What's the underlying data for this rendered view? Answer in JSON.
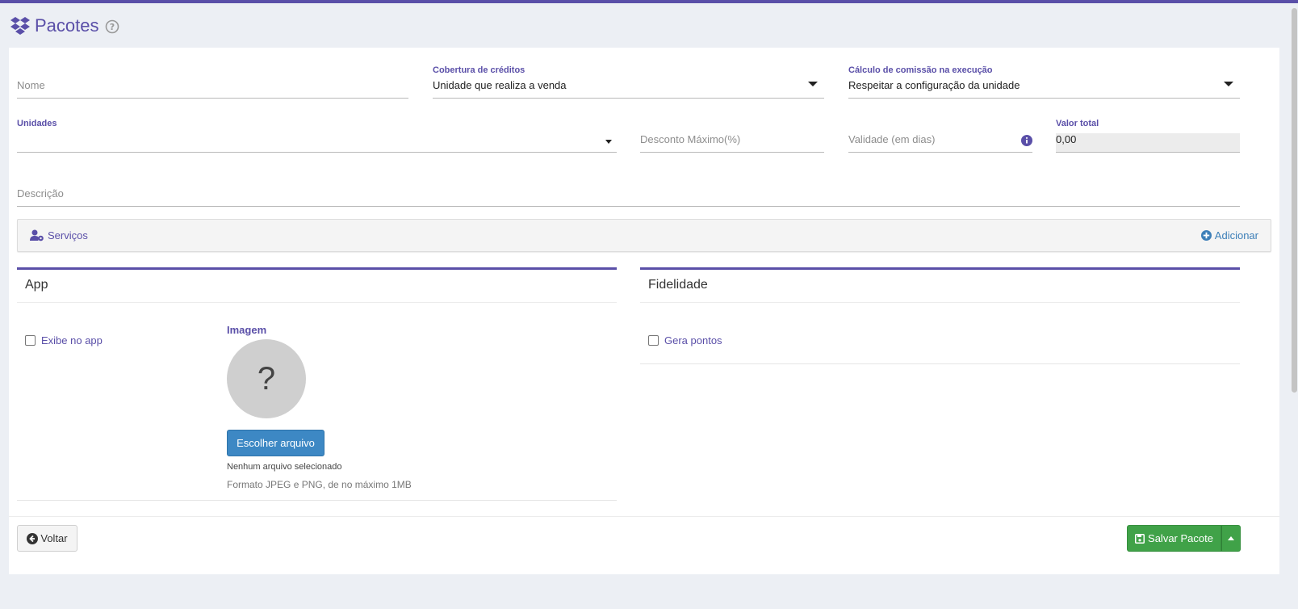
{
  "page": {
    "title": "Pacotes"
  },
  "form": {
    "nome": {
      "placeholder": "Nome",
      "value": ""
    },
    "cobertura": {
      "label": "Cobertura de créditos",
      "value": "Unidade que realiza a venda"
    },
    "comissao": {
      "label": "Cálculo de comissão na execução",
      "value": "Respeitar a configuração da unidade"
    },
    "unidades": {
      "label": "Unidades",
      "value": ""
    },
    "desconto": {
      "placeholder": "Desconto Máximo(%)",
      "value": ""
    },
    "validade": {
      "placeholder": "Validade (em dias)",
      "value": ""
    },
    "valor_total": {
      "label": "Valor total",
      "value": "0,00"
    },
    "descricao": {
      "placeholder": "Descrição",
      "value": ""
    }
  },
  "services": {
    "label": "Serviços",
    "add_label": "Adicionar"
  },
  "app_panel": {
    "title": "App",
    "checkbox_label": "Exibe no app",
    "checked": false,
    "image_label": "Imagem",
    "placeholder_glyph": "?",
    "choose_button": "Escolher arquivo",
    "no_file": "Nenhum arquivo selecionado",
    "format_hint": "Formato JPEG e PNG, de no máximo 1MB"
  },
  "fidelidade_panel": {
    "title": "Fidelidade",
    "checkbox_label": "Gera pontos",
    "checked": false
  },
  "footer": {
    "back_label": "Voltar",
    "save_label": "Salvar Pacote"
  },
  "colors": {
    "accent": "#5a4fa8",
    "link": "#3d7fb8",
    "primary_button": "#3d88c4",
    "success_button": "#40a248"
  },
  "icons": {
    "logo": "dropbox-boxes-icon",
    "help": "question-circle-icon",
    "services": "user-gear-icon",
    "add": "plus-circle-icon",
    "info": "info-circle-icon",
    "back": "arrow-left-circle-icon",
    "save": "floppy-disk-icon"
  }
}
